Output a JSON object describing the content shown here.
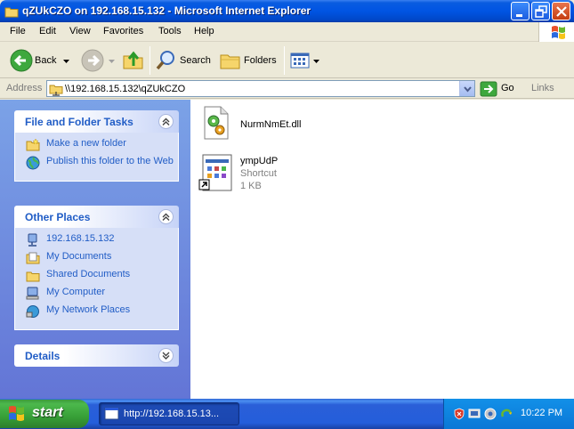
{
  "window": {
    "title": "qZUkCZO on 192.168.15.132 - Microsoft Internet Explorer"
  },
  "menu": {
    "items": [
      "File",
      "Edit",
      "View",
      "Favorites",
      "Tools",
      "Help"
    ]
  },
  "toolbar": {
    "back_label": "Back",
    "search_label": "Search",
    "folders_label": "Folders"
  },
  "address": {
    "label": "Address",
    "value": "\\\\192.168.15.132\\qZUkCZO",
    "go_label": "Go",
    "links_label": "Links"
  },
  "sidebar": {
    "file_tasks": {
      "title": "File and Folder Tasks",
      "items": [
        {
          "label": "Make a new folder",
          "icon": "new-folder-icon"
        },
        {
          "label": "Publish this folder to the Web",
          "icon": "publish-web-icon"
        }
      ]
    },
    "other_places": {
      "title": "Other Places",
      "items": [
        {
          "label": "192.168.15.132",
          "icon": "network-computer-icon"
        },
        {
          "label": "My Documents",
          "icon": "my-documents-icon"
        },
        {
          "label": "Shared Documents",
          "icon": "shared-documents-icon"
        },
        {
          "label": "My Computer",
          "icon": "my-computer-icon"
        },
        {
          "label": "My Network Places",
          "icon": "network-places-icon"
        }
      ]
    },
    "details": {
      "title": "Details"
    }
  },
  "files": [
    {
      "name": "NurmNmEt.dll",
      "icon": "dll-file-icon"
    },
    {
      "name": "ympUdP",
      "type": "Shortcut",
      "size": "1 KB",
      "icon": "shortcut-icon"
    }
  ],
  "taskbar": {
    "start_label": "start",
    "task_label": "http://192.168.15.13...",
    "clock": "10:22 PM"
  },
  "colors": {
    "titlebar": "#0054e3",
    "sidebar_link": "#215dc6",
    "sidebar_bg": "#7ba2e7",
    "taskbar": "#245edb",
    "start": "#37a037"
  }
}
